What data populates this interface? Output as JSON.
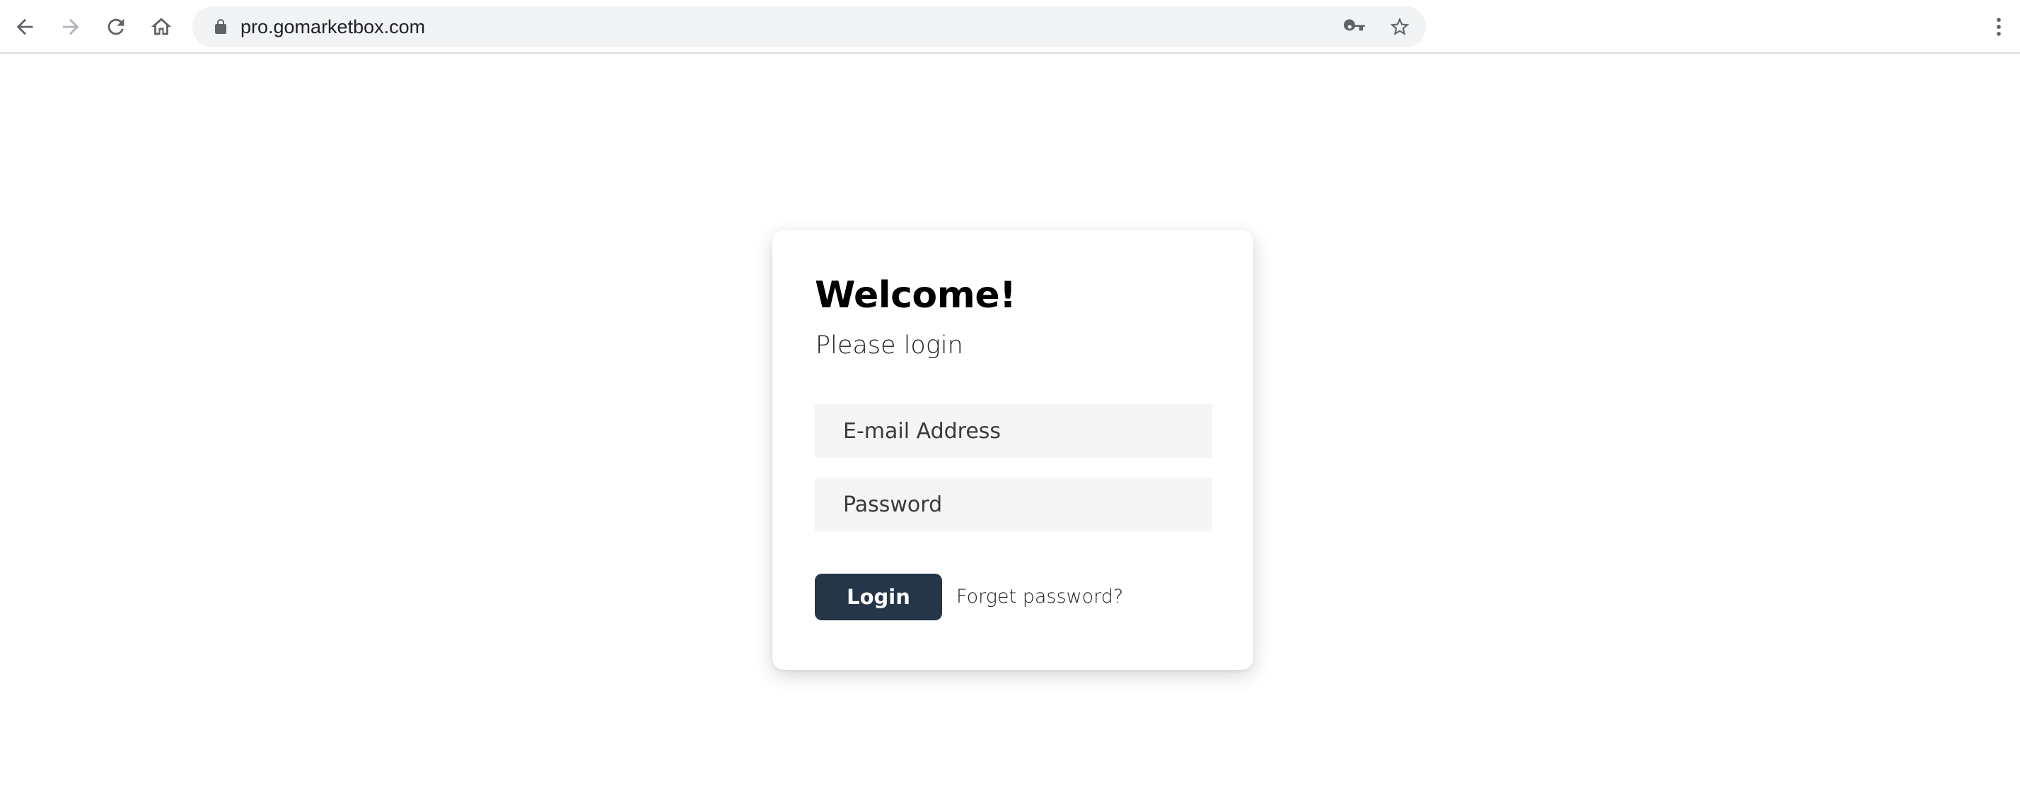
{
  "browser": {
    "url": "pro.gomarketbox.com",
    "icons": {
      "back": "arrow-left-icon",
      "forward": "arrow-right-icon",
      "reload": "reload-icon",
      "home": "home-icon",
      "lock": "lock-icon",
      "password_key": "key-icon",
      "bookmark": "star-icon",
      "menu": "kebab-menu-icon"
    }
  },
  "login": {
    "title": "Welcome!",
    "subtitle": "Please login",
    "email_placeholder": "E-mail Address",
    "password_placeholder": "Password",
    "login_button": "Login",
    "forgot_link": "Forget password?"
  },
  "colors": {
    "button_bg": "#243648",
    "field_bg": "#f5f5f5",
    "omnibox_bg": "#f1f3f4"
  }
}
